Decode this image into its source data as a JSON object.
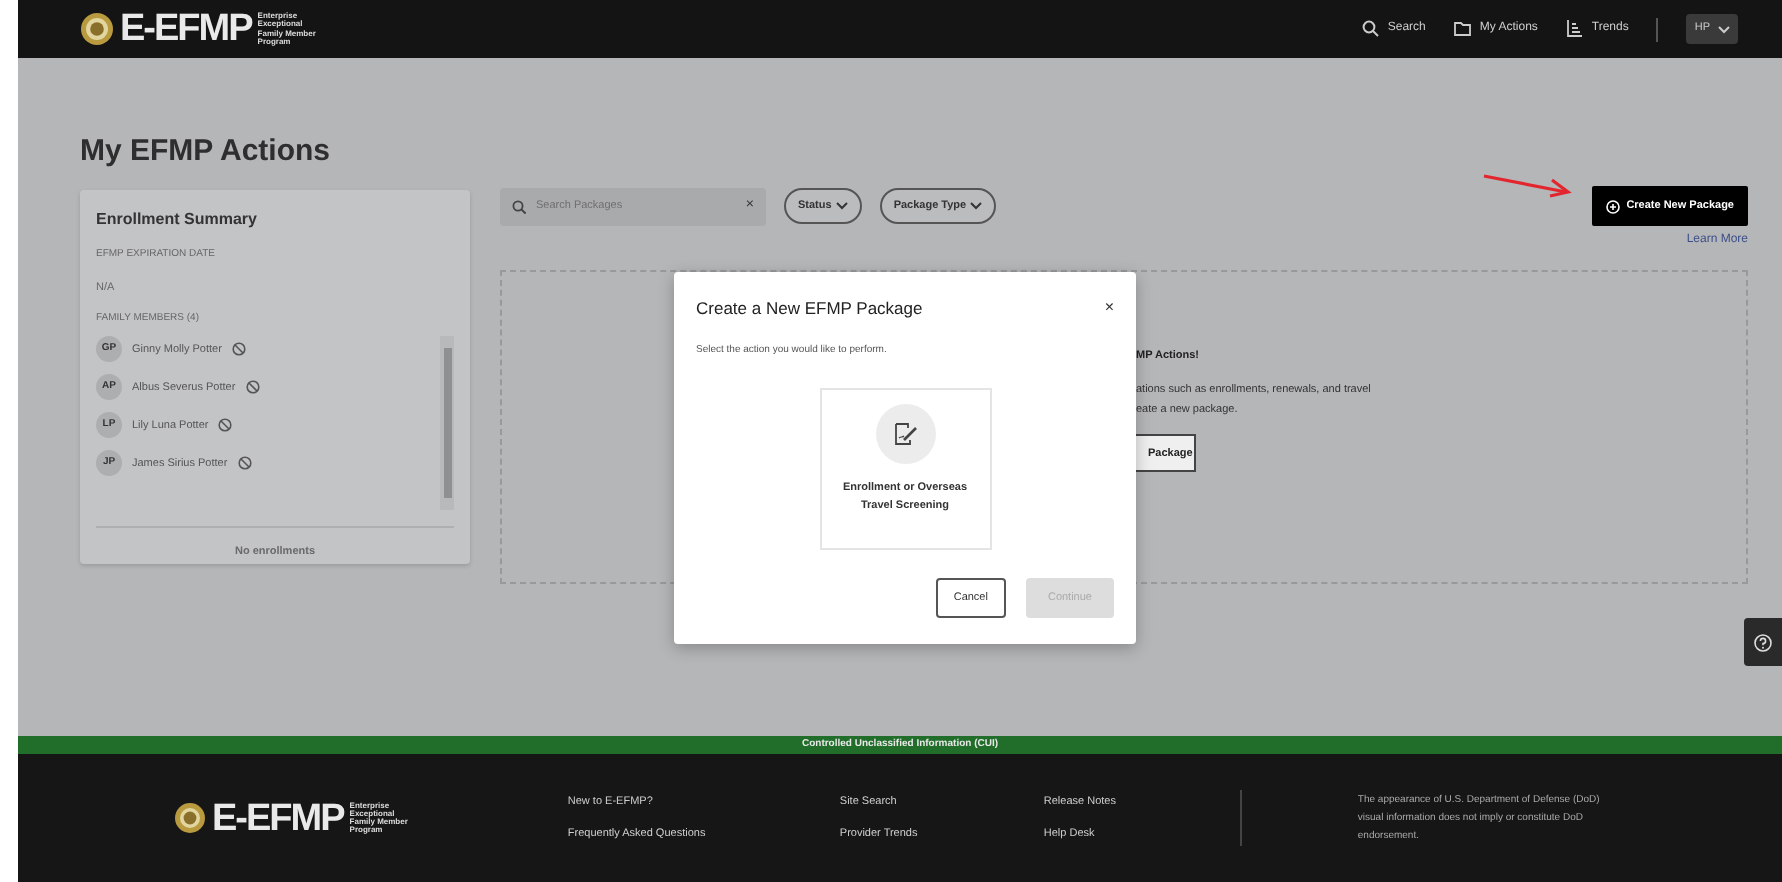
{
  "header": {
    "logo": "E-EFMP",
    "logo_sub": [
      "Enterprise",
      "Exceptional",
      "Family Member",
      "Program"
    ],
    "nav": [
      {
        "label": "Search"
      },
      {
        "label": "My Actions"
      },
      {
        "label": "Trends"
      }
    ],
    "user_initials": "HP"
  },
  "page_title": "My EFMP Actions",
  "enrollment_summary": {
    "title": "Enrollment Summary",
    "expiration_label": "EFMP EXPIRATION DATE",
    "expiration_value": "N/A",
    "family_label": "FAMILY MEMBERS (4)",
    "members": [
      {
        "initials": "GP",
        "name": "Ginny Molly Potter"
      },
      {
        "initials": "AP",
        "name": "Albus Severus Potter"
      },
      {
        "initials": "LP",
        "name": "Lily Luna Potter"
      },
      {
        "initials": "JP",
        "name": "James Sirius Potter"
      }
    ],
    "footer": "No enrollments"
  },
  "toolbar": {
    "search": {
      "placeholder": "Search Packages",
      "clear": "×"
    },
    "filters": [
      "Status",
      "Package Type"
    ],
    "create_button": "Create New Package",
    "learn_more": "Learn More"
  },
  "empty_state": {
    "heading": "MP Actions!",
    "lines": [
      "ations such as enrollments, renewals, and travel",
      "eate a new package."
    ],
    "button": "Package"
  },
  "modal": {
    "title": "Create a New EFMP Package",
    "close": "×",
    "prompt": "Select the action you would like to perform.",
    "options": [
      {
        "label": "Enrollment or Overseas Travel Screening",
        "selected": false
      }
    ],
    "buttons": [
      {
        "label": "Cancel",
        "disabled": false
      },
      {
        "label": "Continue",
        "disabled": true
      }
    ]
  },
  "cui_banner": "Controlled Unclassified Information (CUI)",
  "footer": {
    "logo": "E-EFMP",
    "logo_sub": [
      "Enterprise",
      "Exceptional",
      "Family Member",
      "Program"
    ],
    "link_columns": [
      [
        "New to E-EFMP?",
        "Frequently Asked Questions"
      ],
      [
        "Site Search",
        "Provider Trends"
      ],
      [
        "Release Notes",
        "Help Desk"
      ]
    ],
    "disclaimer": "The appearance of U.S. Department of Defense (DoD) visual information does not imply or constitute DoD endorsement."
  }
}
